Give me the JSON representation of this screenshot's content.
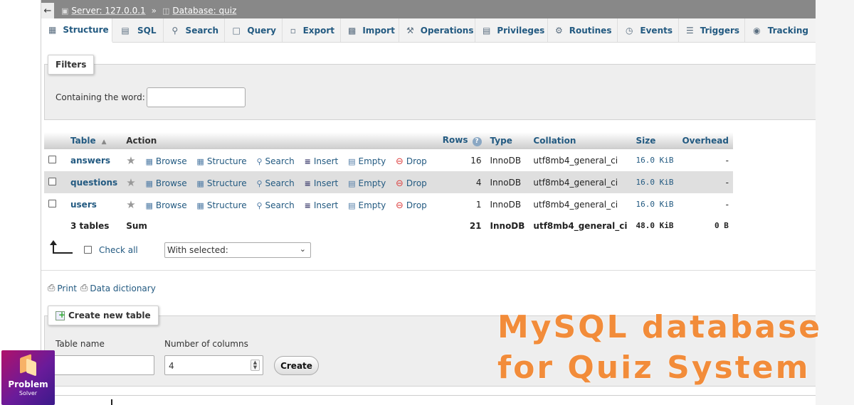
{
  "breadcrumb": {
    "back_icon": "arrow-left-icon",
    "server": "Server: 127.0.0.1",
    "separator": "»",
    "database": "Database: quiz"
  },
  "tabs": [
    {
      "label": "Structure",
      "icon": "structure-icon",
      "active": true
    },
    {
      "label": "SQL",
      "icon": "sql-icon"
    },
    {
      "label": "Search",
      "icon": "search-icon"
    },
    {
      "label": "Query",
      "icon": "query-icon"
    },
    {
      "label": "Export",
      "icon": "export-icon"
    },
    {
      "label": "Import",
      "icon": "import-icon"
    },
    {
      "label": "Operations",
      "icon": "wrench-icon"
    },
    {
      "label": "Privileges",
      "icon": "privileges-icon"
    },
    {
      "label": "Routines",
      "icon": "routines-icon"
    },
    {
      "label": "Events",
      "icon": "clock-icon"
    },
    {
      "label": "Triggers",
      "icon": "triggers-icon"
    },
    {
      "label": "Tracking",
      "icon": "eye-icon"
    }
  ],
  "filters": {
    "legend": "Filters",
    "label": "Containing the word:",
    "value": ""
  },
  "table": {
    "headers": {
      "table": "Table",
      "action": "Action",
      "rows": "Rows",
      "type": "Type",
      "collation": "Collation",
      "size": "Size",
      "overhead": "Overhead"
    },
    "actions": {
      "browse": "Browse",
      "structure": "Structure",
      "search": "Search",
      "insert": "Insert",
      "empty": "Empty",
      "drop": "Drop"
    },
    "rows": [
      {
        "name": "answers",
        "rows": "16",
        "type": "InnoDB",
        "collation": "utf8mb4_general_ci",
        "size": "16.0 KiB",
        "overhead": "-"
      },
      {
        "name": "questions",
        "rows": "4",
        "type": "InnoDB",
        "collation": "utf8mb4_general_ci",
        "size": "16.0 KiB",
        "overhead": "-"
      },
      {
        "name": "users",
        "rows": "1",
        "type": "InnoDB",
        "collation": "utf8mb4_general_ci",
        "size": "16.0 KiB",
        "overhead": "-"
      }
    ],
    "footer": {
      "name": "3 tables",
      "action": "Sum",
      "rows": "21",
      "type": "InnoDB",
      "collation": "utf8mb4_general_ci",
      "size": "48.0 KiB",
      "overhead": "0 B"
    }
  },
  "bulk": {
    "check_all": "Check all",
    "with_selected": "With selected:"
  },
  "links": {
    "print": "Print",
    "data_dictionary": "Data dictionary"
  },
  "create_table": {
    "legend": "Create new table",
    "table_name_label": "Table name",
    "table_name_value": "",
    "columns_label": "Number of columns",
    "columns_value": "4",
    "button": "Create"
  },
  "overlay": {
    "line1": "MySQL database",
    "line2": "for Quiz System",
    "color": "#f28c3a"
  },
  "badge": {
    "line1": "Problem",
    "line2": "Solver"
  },
  "colors": {
    "link": "#235a81",
    "breadcrumb_bg": "#888888",
    "row_alt": "#dfdfdf"
  }
}
